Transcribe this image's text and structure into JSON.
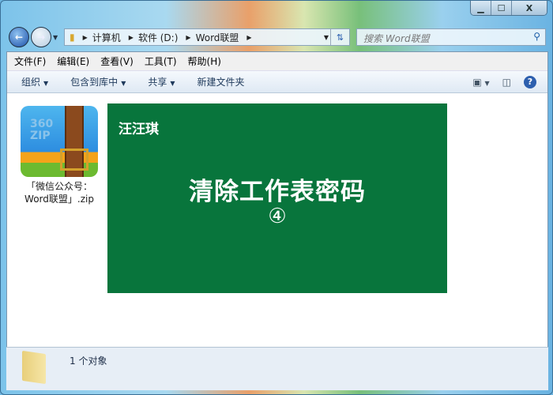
{
  "window": {
    "min": "▁",
    "max": "☐",
    "close": "X"
  },
  "address": {
    "crumbs": [
      "计算机",
      "软件 (D:)",
      "Word联盟"
    ]
  },
  "search": {
    "placeholder": "搜索 Word联盟"
  },
  "menu": [
    "文件(F)",
    "编辑(E)",
    "查看(V)",
    "工具(T)",
    "帮助(H)"
  ],
  "toolbar": {
    "organize": "组织",
    "include": "包含到库中",
    "share": "共享",
    "new_folder": "新建文件夹",
    "help": "?"
  },
  "file": {
    "name": "「微信公众号：Word联盟」.zip",
    "icon_text": "360 ZIP"
  },
  "preview": {
    "author": "汪汪琪",
    "title": "清除工作表密码",
    "number": "④",
    "bg": "#08753c"
  },
  "status": {
    "text": "1 个对象"
  }
}
